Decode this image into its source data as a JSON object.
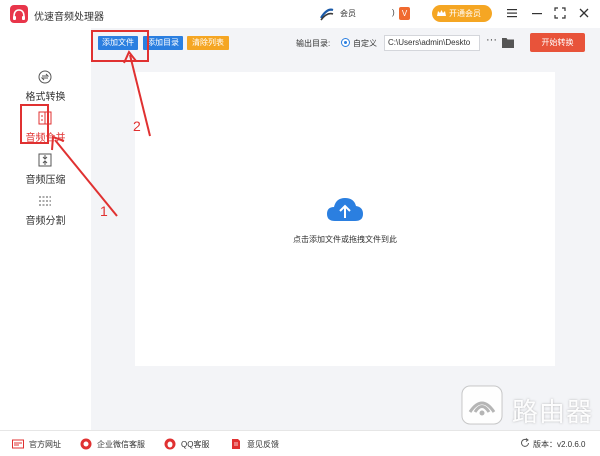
{
  "window": {
    "title": "优速音频处理器",
    "user_name": "会员",
    "vip_badge": "V",
    "vip_button_label": "开通会员"
  },
  "sidebar": {
    "items": [
      {
        "label": "格式转换",
        "icon": "format-convert-icon"
      },
      {
        "label": "音频合并",
        "icon": "audio-merge-icon",
        "active": true
      },
      {
        "label": "音频压缩",
        "icon": "audio-compress-icon"
      },
      {
        "label": "音频分割",
        "icon": "audio-split-icon"
      }
    ]
  },
  "toolbar": {
    "add_file_label": "添加文件",
    "add_dir_label": "添加目录",
    "clear_list_label": "清除列表",
    "output_dir_label": "输出目录:",
    "radio_label": "自定义",
    "path_value": "C:\\Users\\admin\\Deskto",
    "more_label": "···",
    "start_label": "开始转换"
  },
  "main": {
    "drop_hint": "点击添加文件或拖拽文件到此"
  },
  "footer": {
    "items": [
      {
        "label": "官方网址",
        "icon": "website-icon"
      },
      {
        "label": "企业微信客服",
        "icon": "wechat-service-icon"
      },
      {
        "label": "QQ客服",
        "icon": "qq-icon"
      },
      {
        "label": "意见反馈",
        "icon": "feedback-icon"
      }
    ],
    "version": "版本：v2.0.6.0"
  },
  "annotations": {
    "step1": "1",
    "step2": "2"
  },
  "watermark": {
    "text": "路由器"
  },
  "colors": {
    "accent_blue": "#2b7fe0",
    "accent_orange": "#f5a623",
    "start_red": "#e8533a",
    "annotation_red": "#e03131"
  }
}
